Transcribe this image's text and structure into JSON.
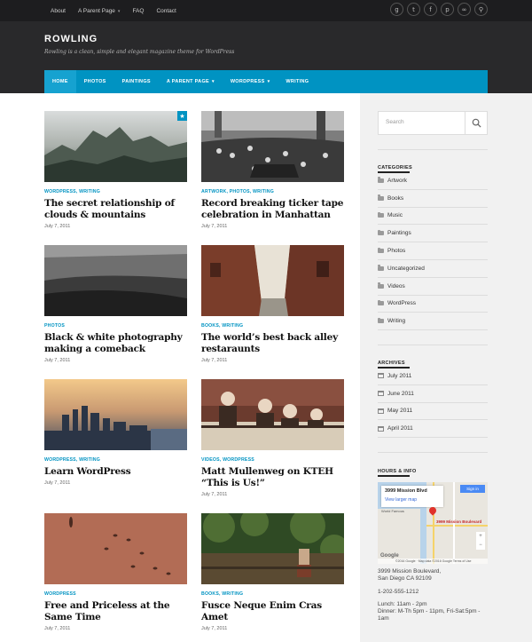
{
  "topnav": [
    {
      "label": "About",
      "caret": false
    },
    {
      "label": "A Parent Page",
      "caret": true
    },
    {
      "label": "FAQ",
      "caret": false
    },
    {
      "label": "Contact",
      "caret": false
    }
  ],
  "socials": [
    {
      "name": "google-plus-icon",
      "glyph": "g"
    },
    {
      "name": "twitter-icon",
      "glyph": "t"
    },
    {
      "name": "facebook-icon",
      "glyph": "f"
    },
    {
      "name": "pinterest-icon",
      "glyph": "p"
    },
    {
      "name": "link-icon",
      "glyph": "∞"
    },
    {
      "name": "search-icon",
      "glyph": "⚲"
    }
  ],
  "site": {
    "title": "ROWLING",
    "tagline": "Rowling is a clean, simple and elegant magazine theme for WordPress"
  },
  "mainnav": [
    {
      "label": "HOME",
      "caret": false,
      "active": true
    },
    {
      "label": "PHOTOS",
      "caret": false,
      "active": false
    },
    {
      "label": "PAINTINGS",
      "caret": false,
      "active": false
    },
    {
      "label": "A PARENT PAGE",
      "caret": true,
      "active": false
    },
    {
      "label": "WORDPRESS",
      "caret": true,
      "active": false
    },
    {
      "label": "WRITING",
      "caret": false,
      "active": false
    }
  ],
  "search": {
    "placeholder": "Search"
  },
  "widgets": {
    "categories_title": "CATEGORIES",
    "categories": [
      "Artwork",
      "Books",
      "Music",
      "Paintings",
      "Photos",
      "Uncategorized",
      "Videos",
      "WordPress",
      "Writing"
    ],
    "archives_title": "ARCHIVES",
    "archives": [
      "July 2011",
      "June 2011",
      "May 2011",
      "April 2011"
    ],
    "hours_title": "HOURS & INFO"
  },
  "map": {
    "place": "3999 Mission Blvd",
    "larger": "View larger map",
    "signin": "Sign in",
    "pin_label": "3999 Mission Boulevard",
    "city": "World Famous",
    "google": "Google",
    "footer": "©2016 Google · Map data ©2016 Google   Terms of Use"
  },
  "info": {
    "address1": "3999 Mission Boulevard,",
    "address2": "San Diego CA 92109",
    "phone": "1-202-555-1212",
    "lunch": "Lunch: 11am - 2pm",
    "dinner1": "Dinner: M-Th 5pm - 11pm, Fri-Sat:5pm -",
    "dinner2": "1am"
  },
  "posts": [
    {
      "cats": "WORDPRESS, WRITING",
      "title": "The secret relationship of clouds & mountains",
      "date": "July 7, 2011",
      "image": "misty-mountains",
      "sticky": true
    },
    {
      "cats": "ARTWORK, PHOTOS, WRITING",
      "title": "Record breaking ticker tape celebration in Manhattan",
      "date": "July 7, 2011",
      "image": "parade-crowd",
      "sticky": false
    },
    {
      "cats": "PHOTOS",
      "title": "Black & white photography making a comeback",
      "date": "July 7, 2011",
      "image": "bw-landscape",
      "sticky": false
    },
    {
      "cats": "BOOKS, WRITING",
      "title": "The world’s best back alley restaraunts",
      "date": "July 7, 2011",
      "image": "brick-alley",
      "sticky": false
    },
    {
      "cats": "WORDPRESS, WRITING",
      "title": "Learn WordPress",
      "date": "July 7, 2011",
      "image": "city-sunset",
      "sticky": false
    },
    {
      "cats": "VIDEOS, WORDPRESS",
      "title": "Matt Mullenweg on KTEH “This is Us!”",
      "date": "July 7, 2011",
      "image": "men-at-railing",
      "sticky": false
    },
    {
      "cats": "WORDPRESS",
      "title": "Free and Priceless at the Same Time",
      "date": "July 7, 2011",
      "image": "birds-on-ground",
      "sticky": false
    },
    {
      "cats": "BOOKS, WRITING",
      "title": "Fusce Neque Enim Cras Amet",
      "date": "July 7, 2011",
      "image": "woman-in-forest",
      "sticky": false
    }
  ]
}
